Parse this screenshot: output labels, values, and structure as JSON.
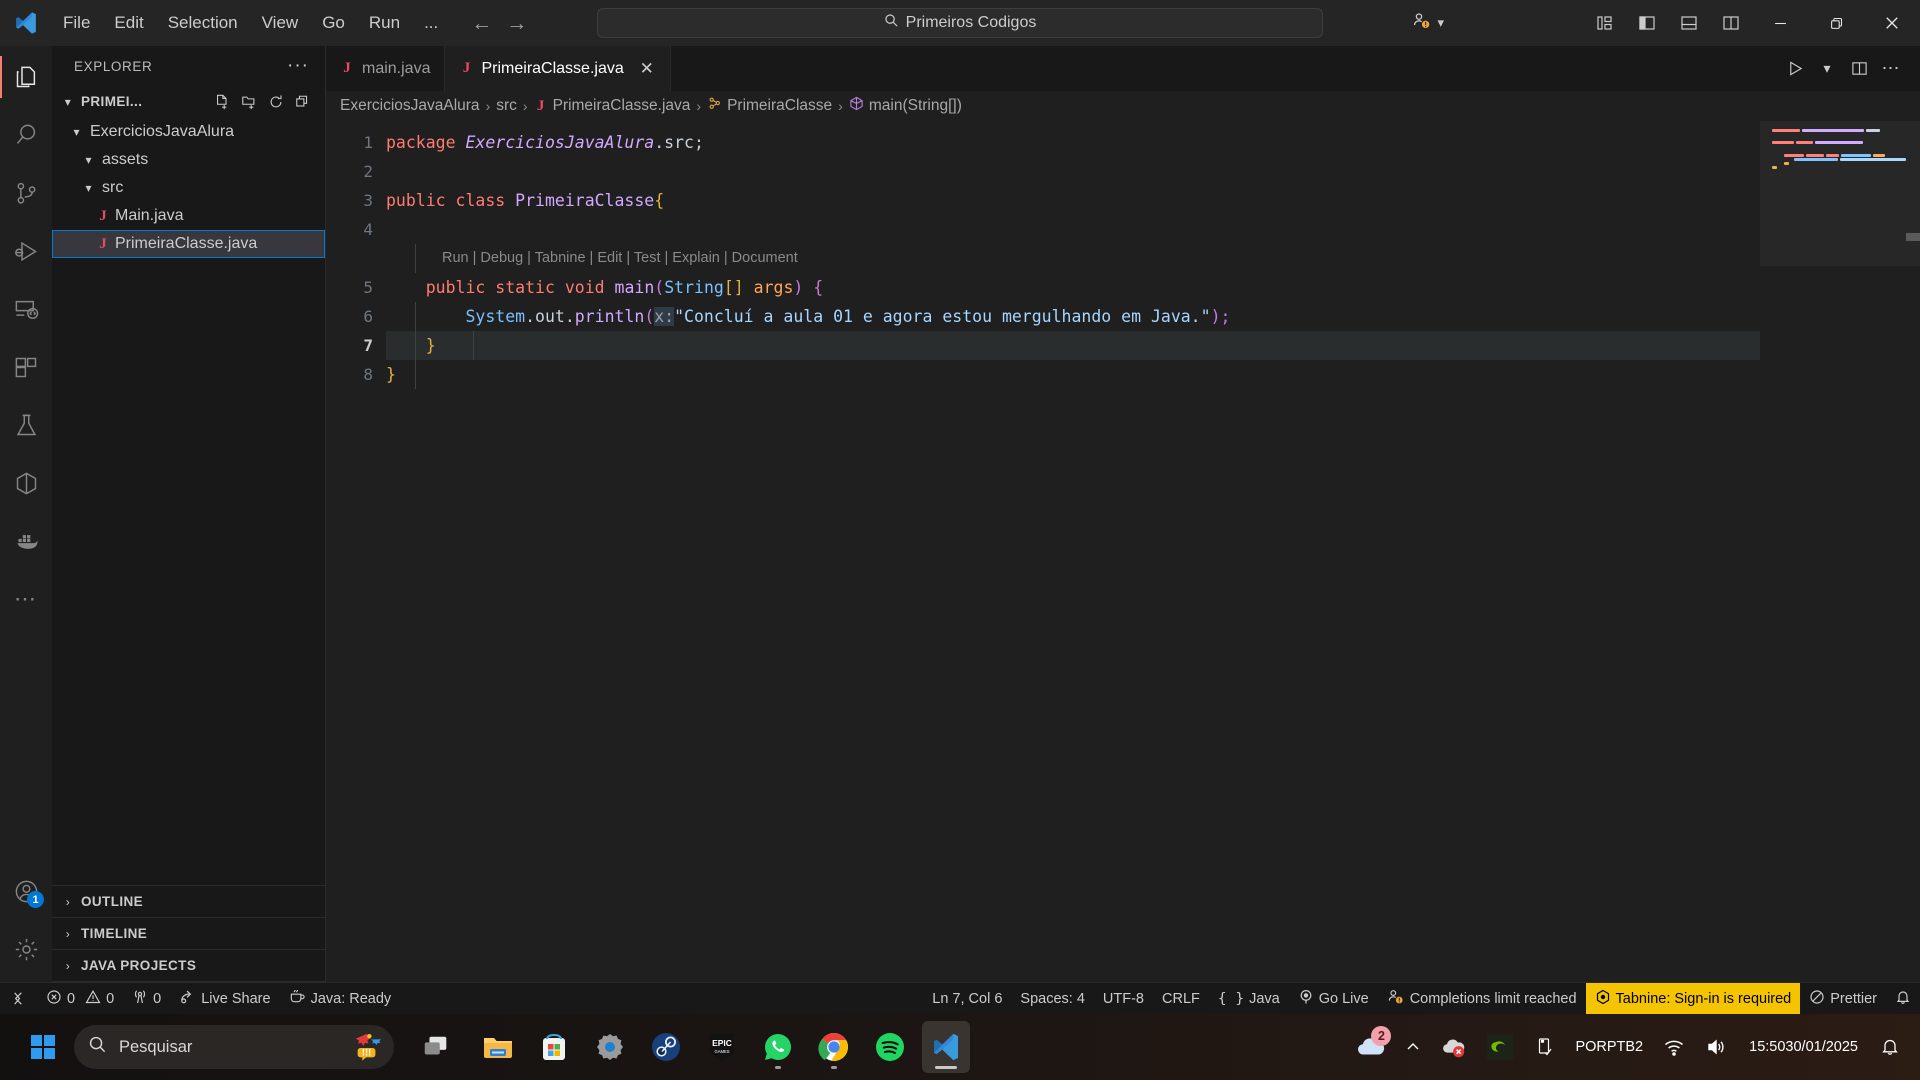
{
  "titlebar": {
    "menu": [
      "File",
      "Edit",
      "Selection",
      "View",
      "Go",
      "Run",
      "..."
    ],
    "nav_back": "←",
    "nav_forward": "→",
    "search_value": "Primeiros Codigos",
    "search_icon": "search-icon",
    "accounts_icon": "accounts-warning-icon",
    "layout_buttons": [
      "customize-layout",
      "toggle-primary-sidebar",
      "toggle-panel",
      "toggle-secondary-sidebar"
    ],
    "window_buttons": [
      "minimize",
      "restore",
      "close"
    ]
  },
  "activitybar": {
    "items": [
      {
        "name": "explorer",
        "icon": "files-icon",
        "active": true
      },
      {
        "name": "search",
        "icon": "search-icon",
        "active": false
      },
      {
        "name": "source-control",
        "icon": "source-control-icon",
        "active": false
      },
      {
        "name": "run-and-debug",
        "icon": "run-debug-icon",
        "active": false
      },
      {
        "name": "remote-explorer",
        "icon": "remote-explorer-icon",
        "active": false
      },
      {
        "name": "extensions",
        "icon": "extensions-icon",
        "active": false
      },
      {
        "name": "testing",
        "icon": "beaker-icon",
        "active": false
      },
      {
        "name": "containers",
        "icon": "cube-icon",
        "active": false
      },
      {
        "name": "docker",
        "icon": "docker-whale-icon",
        "active": false
      },
      {
        "name": "additional-views",
        "icon": "ellipsis-icon",
        "active": false
      }
    ],
    "accounts": {
      "icon": "account-icon",
      "badge": "1"
    },
    "settings": {
      "icon": "gear-icon"
    }
  },
  "sidebar": {
    "title": "EXPLORER",
    "more_actions": "···",
    "folder": {
      "label": "PRIMEI...",
      "chevron": "⌄",
      "actions": [
        "new-file",
        "new-folder",
        "refresh-explorer",
        "collapse-folders"
      ]
    },
    "tree": [
      {
        "label": "ExerciciosJavaAlura",
        "type": "folder",
        "depth": 1,
        "expanded": true,
        "selected": false
      },
      {
        "label": "assets",
        "type": "folder",
        "depth": 2,
        "expanded": true,
        "selected": false
      },
      {
        "label": "src",
        "type": "folder",
        "depth": 2,
        "expanded": true,
        "selected": false
      },
      {
        "label": "Main.java",
        "type": "java-file",
        "depth": 3,
        "expanded": false,
        "selected": false
      },
      {
        "label": "PrimeiraClasse.java",
        "type": "java-file",
        "depth": 3,
        "expanded": false,
        "selected": true
      }
    ],
    "bottom_sections": [
      {
        "label": "OUTLINE",
        "chevron": "›"
      },
      {
        "label": "TIMELINE",
        "chevron": "›"
      },
      {
        "label": "JAVA PROJECTS",
        "chevron": "›"
      }
    ]
  },
  "editor": {
    "tabs": [
      {
        "label": "main.java",
        "icon": "java-file-icon",
        "active": false,
        "close": ""
      },
      {
        "label": "PrimeiraClasse.java",
        "icon": "java-file-icon",
        "active": true,
        "close": "✕"
      }
    ],
    "actions": [
      "run-button",
      "run-dropdown-chevron",
      "split-editor-right",
      "more-editor-actions"
    ],
    "breadcrumb": [
      {
        "label": "ExerciciosJavaAlura",
        "icon": ""
      },
      {
        "label": "src",
        "icon": ""
      },
      {
        "label": "PrimeiraClasse.java",
        "icon": "java-file-icon"
      },
      {
        "label": "PrimeiraClasse",
        "icon": "class-symbol-icon"
      },
      {
        "label": "main(String[])",
        "icon": "method-symbol-icon"
      }
    ],
    "breadcrumb_separator": "›",
    "line_numbers": [
      "1",
      "2",
      "3",
      "4",
      "5",
      "6",
      "7",
      "8"
    ],
    "current_line": 7,
    "codelens": "Run | Debug | Tabnine | Edit | Test | Explain | Document",
    "code": {
      "l1_kw": "package",
      "l1_pkg": "ExerciciosJavaAlura",
      "l1_tail": ".src;",
      "l3_kw1": "public",
      "l3_kw2": "class",
      "l3_name": "PrimeiraClasse",
      "l3_brace": "{",
      "l5_kw1": "public",
      "l5_kw2": "static",
      "l5_kw3": "void",
      "l5_fn": "main",
      "l5_type": "String",
      "l5_brackets": "[]",
      "l5_param": "args",
      "l5_tail": ") {",
      "l6_obj": "System",
      "l6_field": ".out.",
      "l6_method": "println",
      "l6_hint": "x:",
      "l6_string": "\"Concluí a aula 01 e agora estou mergulhando em Java.\"",
      "l6_tail": ");",
      "l7_brace": "}",
      "l8_brace": "}"
    }
  },
  "statusbar": {
    "remote_icon": "remote-window-icon",
    "errors_icon": "error-icon",
    "errors": "0",
    "warnings_icon": "warning-icon",
    "warnings": "0",
    "ports_icon": "radio-tower-icon",
    "ports": "0",
    "live_share_icon": "live-share-icon",
    "live_share": "Live Share",
    "java_icon": "coffee-icon",
    "java_status": "Java: Ready",
    "cursor_position": "Ln 7, Col 6",
    "indentation": "Spaces: 4",
    "encoding": "UTF-8",
    "eol": "CRLF",
    "language_icon": "braces-icon",
    "language": "Java",
    "golive_icon": "broadcast-icon",
    "golive": "Go Live",
    "completions_icon": "accounts-warning-icon",
    "completions": "Completions limit reached",
    "tabnine_icon": "tabnine-icon",
    "tabnine": "Tabnine: Sign-in is required",
    "tabnine_bg": "#f5c400",
    "prettier_icon": "circle-slash-icon",
    "prettier": "Prettier",
    "bell_icon": "bell-icon"
  },
  "taskbar": {
    "start_icon": "windows-start-icon",
    "search_icon": "search-icon",
    "search_placeholder": "Pesquisar",
    "search_widget_icon": "confetti-icon",
    "taskview_icon": "task-view-icon",
    "apps": [
      {
        "name": "file-explorer",
        "active": false,
        "running": false
      },
      {
        "name": "microsoft-store",
        "active": false,
        "running": false
      },
      {
        "name": "settings",
        "active": false,
        "running": false
      },
      {
        "name": "steam",
        "active": false,
        "running": false
      },
      {
        "name": "epic-games",
        "active": false,
        "running": false
      },
      {
        "name": "whatsapp",
        "active": false,
        "running": true
      },
      {
        "name": "google-chrome",
        "active": false,
        "running": true
      },
      {
        "name": "spotify",
        "active": false,
        "running": false
      },
      {
        "name": "visual-studio-code",
        "active": true,
        "running": true
      }
    ],
    "tray": {
      "onedrive_badge": "2",
      "chevron": "⌃",
      "items": [
        "onedrive-icon",
        "show-hidden-icons",
        "onedrive-error-icon",
        "nvidia-icon",
        "usb-eject-icon"
      ],
      "language_line1": "POR",
      "language_line2": "PTB2",
      "wifi_icon": "wifi-icon",
      "volume_icon": "volume-icon",
      "time": "15:50",
      "date": "30/01/2025",
      "notifications_icon": "bell-icon"
    }
  }
}
